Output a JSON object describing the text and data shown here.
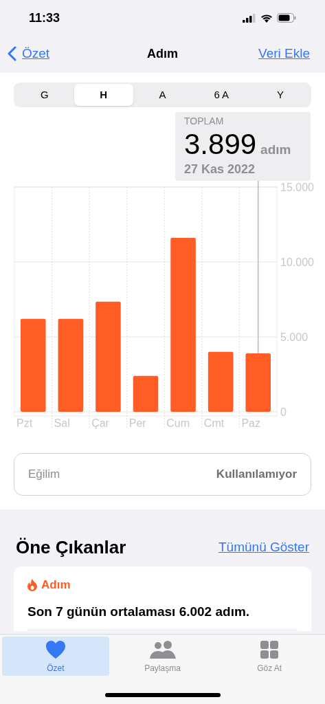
{
  "status_bar": {
    "time": "11:33"
  },
  "nav": {
    "back": "Özet",
    "title": "Adım",
    "action": "Veri Ekle"
  },
  "segments": [
    {
      "label": "G",
      "selected": false
    },
    {
      "label": "H",
      "selected": true
    },
    {
      "label": "A",
      "selected": false
    },
    {
      "label": "6 A",
      "selected": false
    },
    {
      "label": "Y",
      "selected": false
    }
  ],
  "tooltip": {
    "label": "TOPLAM",
    "value": "3.899",
    "unit": "adım",
    "date": "27 Kas 2022"
  },
  "chart_data": {
    "type": "bar",
    "categories": [
      "Pzt",
      "Sal",
      "Çar",
      "Per",
      "Cum",
      "Cmt",
      "Paz"
    ],
    "series": [
      {
        "color": "#ff5c26",
        "values": [
          6200,
          6200,
          7350,
          2400,
          11600,
          4000,
          3900
        ]
      }
    ],
    "ylim": [
      0,
      15000
    ],
    "yticks": [
      {
        "value": 0,
        "label": "0"
      },
      {
        "value": 5000,
        "label": "5.000"
      },
      {
        "value": 10000,
        "label": "10.000"
      },
      {
        "value": 15000,
        "label": "15.000"
      }
    ],
    "annotations": [
      {
        "x": "Paz"
      }
    ]
  },
  "trend": {
    "label": "Eğilim",
    "value": "Kullanılamıyor"
  },
  "highlights": {
    "title": "Öne Çıkanlar",
    "link": "Tümünü Göster",
    "card": {
      "category": "Adım",
      "text": "Son 7 günün ortalaması 6.002 adım."
    }
  },
  "tab_bar": [
    {
      "label": "Özet",
      "kind": "heart",
      "selected": true
    },
    {
      "label": "Paylaşma",
      "kind": "people",
      "selected": false
    },
    {
      "label": "Göz At",
      "kind": "grid",
      "selected": false
    }
  ]
}
